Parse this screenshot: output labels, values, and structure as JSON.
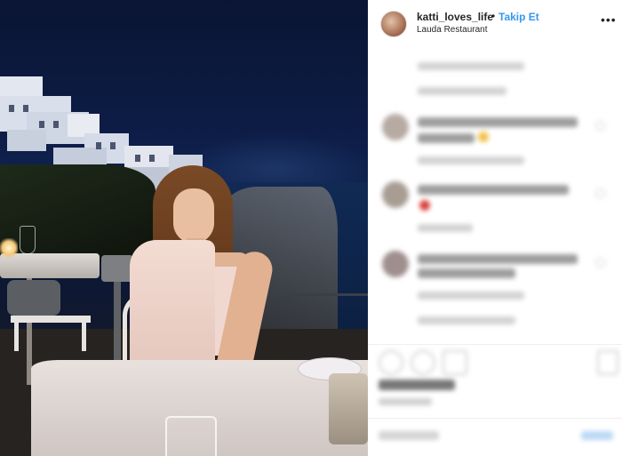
{
  "post": {
    "username": "katti_loves_life",
    "separator": "•",
    "follow_label": "Takip Et",
    "location": "Lauda Restaurant",
    "more_glyph": "•••"
  },
  "icons": {
    "avatar": "profile-avatar",
    "more": "more-options-icon",
    "like": "heart-icon",
    "comment": "comment-icon",
    "share": "share-icon",
    "save": "bookmark-icon"
  },
  "colors": {
    "follow_link": "#3897f0",
    "text": "#262626",
    "sidebar_bg": "#ffffff"
  }
}
